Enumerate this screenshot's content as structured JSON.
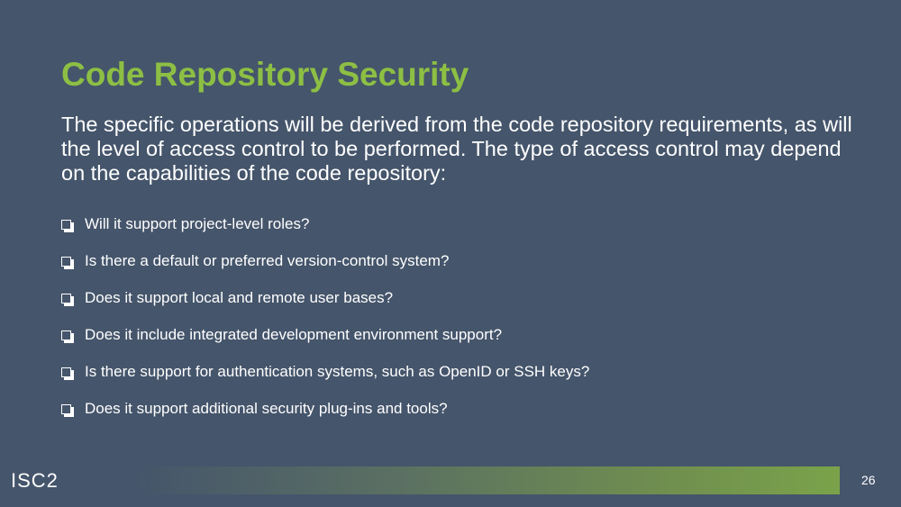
{
  "slide": {
    "title": "Code Repository Security",
    "intro": "The specific operations will be derived from the code repository requirements, as will the level of access control to be performed. The type of access control may depend on the capabilities of the code repository:",
    "checklist": [
      "Will it support project-level roles?",
      "Is there a default or preferred version-control system?",
      "Does it support local and remote user bases?",
      "Does it include integrated development environment support?",
      "Is there support for authentication systems, such as OpenID or SSH keys?",
      "Does it support additional security plug-ins and tools?"
    ],
    "bullet_icon": "checkbox-icon"
  },
  "footer": {
    "logo_text": "ISC2",
    "page_number": "26"
  },
  "colors": {
    "background": "#45556b",
    "title": "#8dbf44",
    "text": "#ffffff",
    "footer_bar_end": "#7aa24a"
  }
}
